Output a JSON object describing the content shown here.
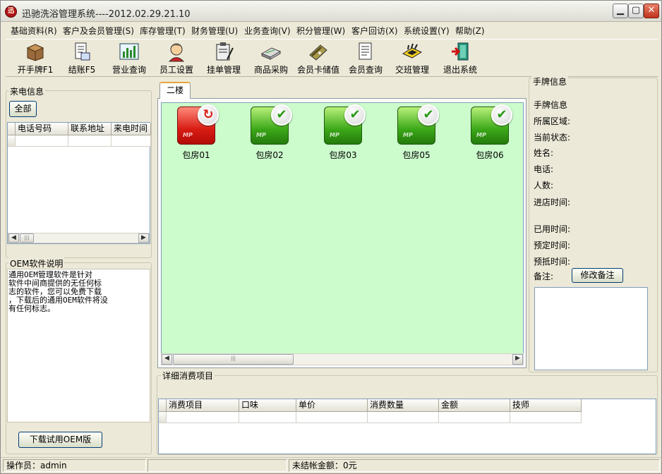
{
  "window": {
    "title": "迅驰洗浴管理系统----2012.02.29.21.10",
    "app_icon_text": "迅"
  },
  "titlebar_buttons": {
    "minimize": "▁",
    "restore": "▢",
    "close": "✕"
  },
  "menu": [
    "基础资料(R)",
    "客户及会员管理(S)",
    "库存管理(T)",
    "财务管理(U)",
    "业务查询(V)",
    "积分管理(W)",
    "客户回访(X)",
    "系统设置(Y)",
    "帮助(Z)"
  ],
  "toolbar": [
    {
      "label": "开手牌F1",
      "icon": "box-icon"
    },
    {
      "label": "结账F5",
      "icon": "receipt-icon"
    },
    {
      "label": "营业查询",
      "icon": "chart-icon"
    },
    {
      "label": "员工设置",
      "icon": "person-icon"
    },
    {
      "label": "挂单管理",
      "icon": "clipboard-icon"
    },
    {
      "label": "商品采购",
      "icon": "product-icon"
    },
    {
      "label": "会员卡储值",
      "icon": "card-icon"
    },
    {
      "label": "会员查询",
      "icon": "document-icon"
    },
    {
      "label": "交班管理",
      "icon": "chip-icon"
    },
    {
      "label": "退出系统",
      "icon": "exit-door-icon"
    }
  ],
  "caller_info": {
    "group_title": "来电信息",
    "all_button": "全部",
    "columns": [
      "电话号码",
      "联系地址",
      "来电时间"
    ]
  },
  "oem": {
    "group_title": "OEM软件说明",
    "text": "通用OEM管理软件是针对\n软件中间商提供的无任何标\n志的软件，您可以免费下载\n，下载后的通用OEM软件将没\n有任何标志。",
    "download_button": "下载试用OEM版"
  },
  "floor_tab": "二楼",
  "rooms": [
    {
      "name": "包房01",
      "status": "busy"
    },
    {
      "name": "包房02",
      "status": "free"
    },
    {
      "name": "包房03",
      "status": "free"
    },
    {
      "name": "包房05",
      "status": "free"
    },
    {
      "name": "包房06",
      "status": "free"
    }
  ],
  "room_icon_text": "MP",
  "status_symbols": {
    "busy": "↻",
    "free": "✔"
  },
  "wristband_info": {
    "group_title": "手牌信息",
    "labels": [
      "手牌信息",
      "所属区域:",
      "当前状态:",
      "姓名:",
      "电话:",
      "人数:",
      "进店时间:",
      "已用时间:",
      "预定时间:",
      "预抵时间:",
      "备注:"
    ],
    "edit_remark_button": "修改备注"
  },
  "details": {
    "group_title": "详细消费项目",
    "columns": [
      "消费项目",
      "口味",
      "单价",
      "消费数量",
      "金额",
      "技师"
    ]
  },
  "statusbar": {
    "operator": "操作员：admin",
    "unsettled": "未结帐金额：0元"
  },
  "colors": {
    "room_area_bg": "#ccfccc",
    "busy_red": "#d81c14",
    "free_green": "#3ca818",
    "tab_accent": "#e6a63a"
  }
}
